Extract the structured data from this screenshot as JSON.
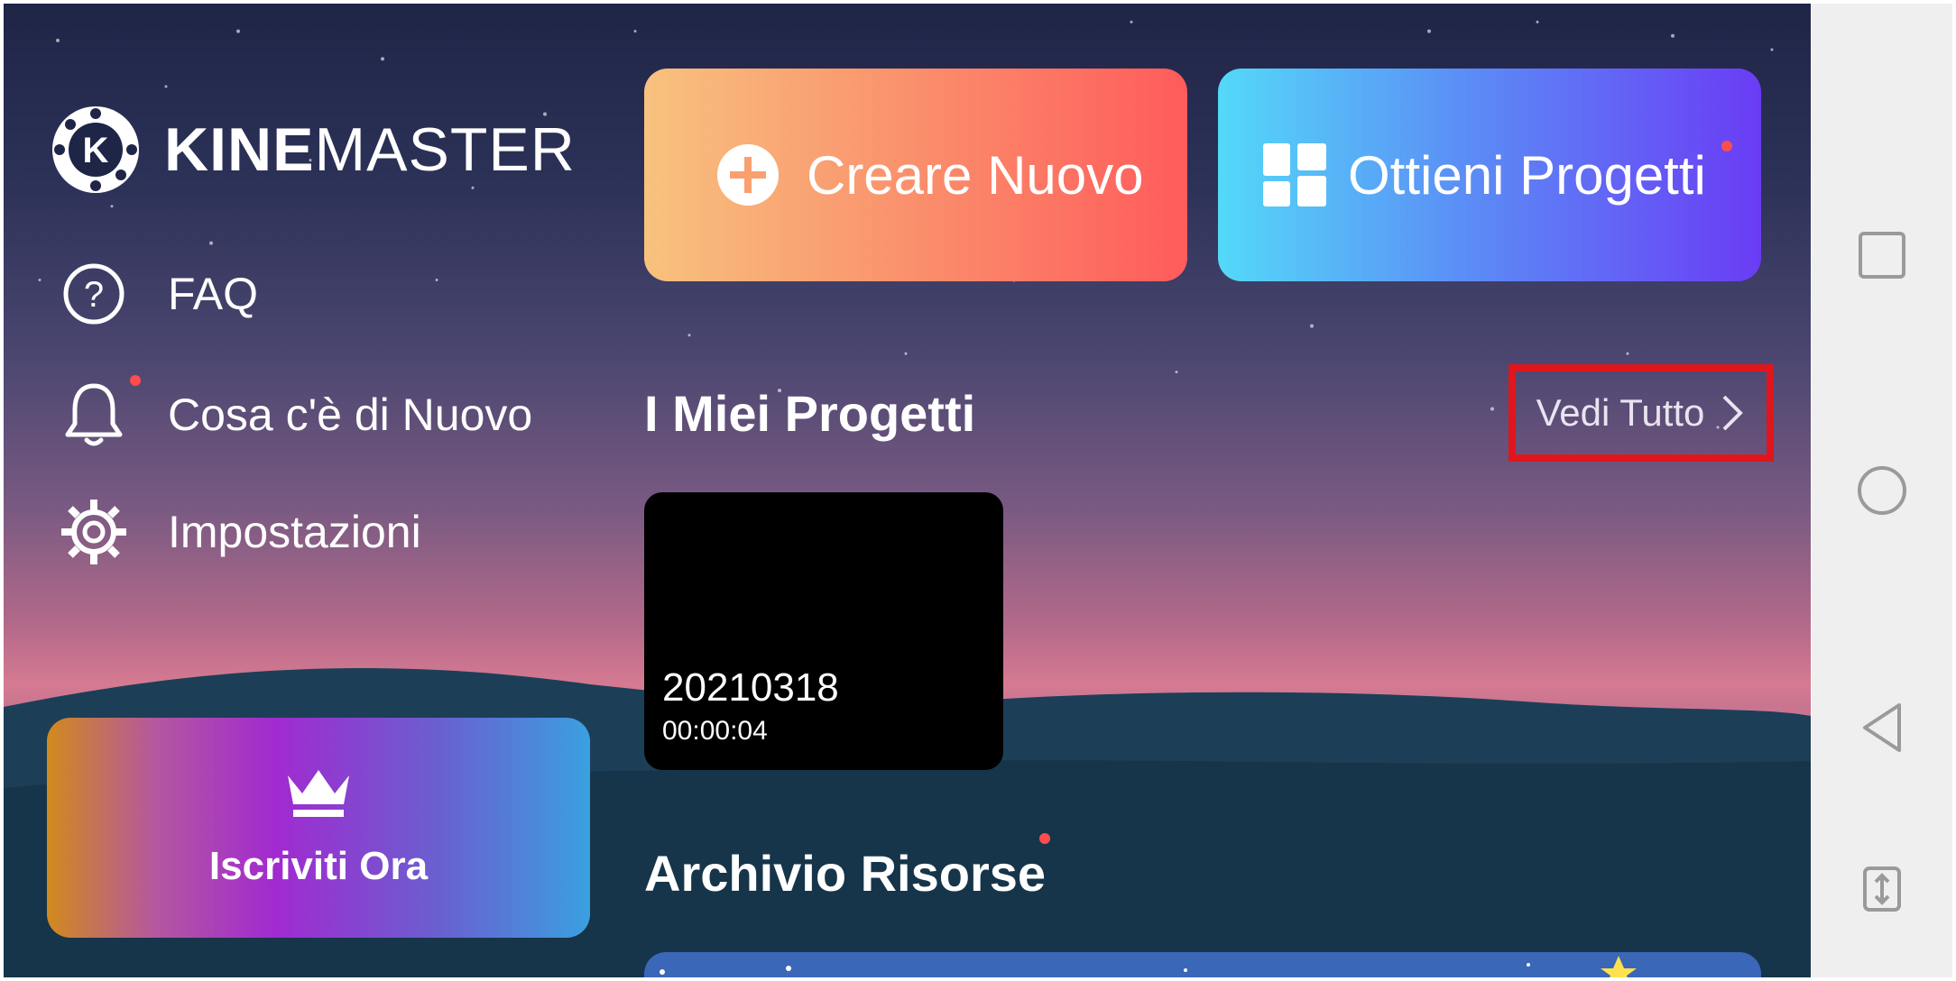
{
  "app": {
    "logo_text_bold": "KINE",
    "logo_text_light": "MASTER",
    "logo_letter": "K"
  },
  "menu": {
    "faq": "FAQ",
    "whats_new": "Cosa c'è di Nuovo",
    "settings": "Impostazioni"
  },
  "subscribe": {
    "label": "Iscriviti Ora"
  },
  "actions": {
    "create_new": "Creare Nuovo",
    "get_projects": "Ottieni Progetti"
  },
  "projects": {
    "title": "I Miei Progetti",
    "see_all": "Vedi Tutto",
    "items": [
      {
        "name": "20210318",
        "duration": "00:00:04"
      }
    ]
  },
  "assets": {
    "title": "Archivio Risorse"
  },
  "colors": {
    "notification_dot": "#ff4d4d",
    "highlight_border": "#e0161c"
  }
}
